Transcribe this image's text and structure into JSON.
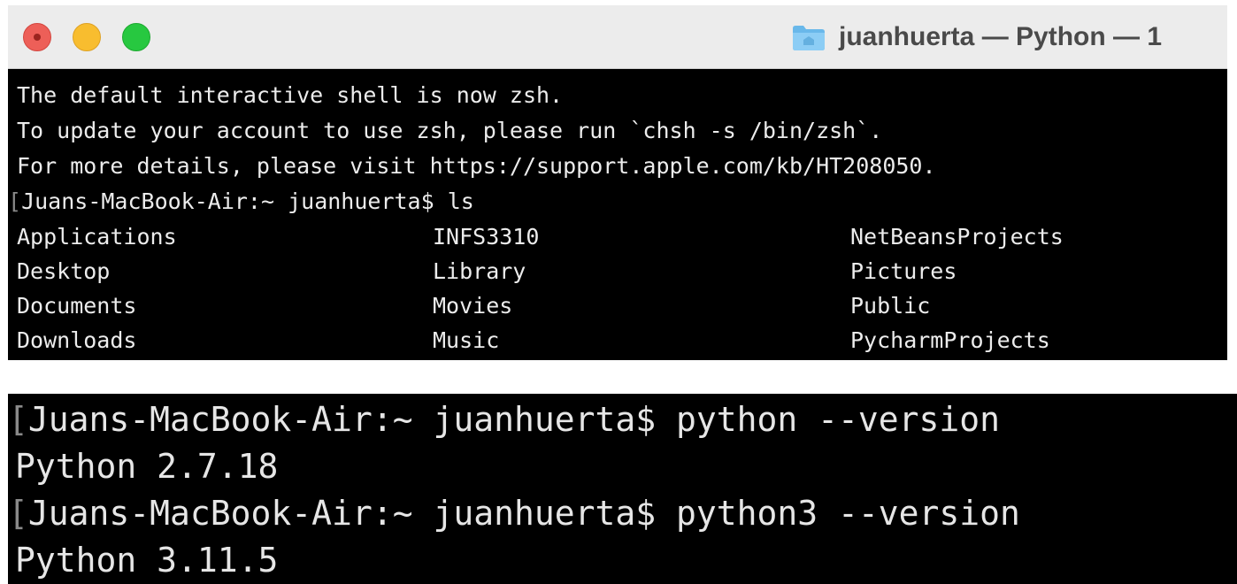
{
  "window": {
    "title": "juanhuerta — Python — 1",
    "colors": {
      "close": "#ed5f58",
      "minimize": "#f8bd2f",
      "maximize": "#27c840",
      "terminal_bg": "#000000",
      "terminal_fg": "#ececec"
    }
  },
  "terminal_top": {
    "lines": [
      "The default interactive shell is now zsh.",
      "To update your account to use zsh, please run `chsh -s /bin/zsh`.",
      "For more details, please visit https://support.apple.com/kb/HT208050."
    ],
    "prompt": {
      "bracket": "[",
      "text": "Juans-MacBook-Air:~ juanhuerta$ ls"
    },
    "ls_rows": [
      [
        "Applications",
        "INFS3310",
        "NetBeansProjects"
      ],
      [
        "Desktop",
        "Library",
        "Pictures"
      ],
      [
        "Documents",
        "Movies",
        "Public"
      ],
      [
        "Downloads",
        "Music",
        "PycharmProjects"
      ]
    ]
  },
  "terminal_bottom": {
    "lines": [
      {
        "bracket": "[",
        "text": "Juans-MacBook-Air:~ juanhuerta$ python --version"
      },
      {
        "bracket": "",
        "text": "Python 2.7.18"
      },
      {
        "bracket": "[",
        "text": "Juans-MacBook-Air:~ juanhuerta$ python3 --version"
      },
      {
        "bracket": "",
        "text": "Python 3.11.5"
      }
    ]
  }
}
